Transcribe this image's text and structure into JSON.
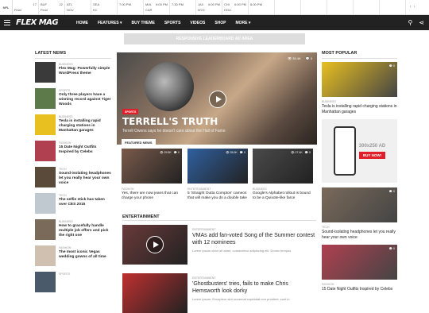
{
  "ticker": {
    "league": "NFL",
    "games": [
      {
        "t1": "",
        "s1": "17",
        "t2": "",
        "s2": "",
        "status": "Final"
      },
      {
        "t1": "BUF",
        "s1": "22",
        "t2": "",
        "s2": "",
        "status": "Final"
      },
      {
        "t1": "ATL",
        "s1": "",
        "t2": "",
        "s2": "",
        "status": "NOV"
      },
      {
        "t1": "SEA",
        "s1": "",
        "t2": "",
        "s2": "",
        "status": "KC"
      },
      {
        "t1": "",
        "s1": "",
        "t2": "",
        "s2": "",
        "status": "7:00 PM"
      },
      {
        "t1": "MIA",
        "s1": "",
        "t2": "CAR",
        "s2": "",
        "status": "6:00 PM"
      },
      {
        "t1": "",
        "s1": "",
        "t2": "",
        "s2": "",
        "status": "7:30 PM"
      },
      {
        "t1": "JAX",
        "s1": "",
        "t2": "NYG",
        "s2": "",
        "status": "6:00 PM"
      },
      {
        "t1": "CHI",
        "s1": "",
        "t2": "HOU",
        "s2": "",
        "status": "6:00 PM"
      },
      {
        "t1": "",
        "s1": "",
        "t2": "",
        "s2": "",
        "status": "6:00 PM"
      }
    ]
  },
  "nav": {
    "logo": "FLEX MAG",
    "items": [
      "HOME",
      "FEATURES ▾",
      "BUY THEME",
      "SPORTS",
      "VIDEOS",
      "SHOP",
      "MORE ▾"
    ]
  },
  "ad": {
    "text": "RESPONSIVE LEADERBOARD AD AREA"
  },
  "latest": {
    "title": "LATEST NEWS",
    "items": [
      {
        "cat": "BUSINESS",
        "title": "Flex Mag: Powerfully simple WordPress theme",
        "color": "#3a3a3a"
      },
      {
        "cat": "SPORTS",
        "title": "Only three players have a winning record against Tiger Woods",
        "color": "#5d7a4a"
      },
      {
        "cat": "BUSINESS",
        "title": "Tesla is installing rapid charging stations in Manhattan garages",
        "color": "#e8c020"
      },
      {
        "cat": "FASHION",
        "title": "15 Date Night Outfits Inspired by Celebs",
        "color": "#b04050"
      },
      {
        "cat": "TECH",
        "title": "Sound-isolating headphones let you really hear your own voice",
        "color": "#5a4a3a"
      },
      {
        "cat": "TECH",
        "title": "The selfie stick has taken over CES 2015",
        "color": "#c0c8d0"
      },
      {
        "cat": "BUSINESS",
        "title": "How to gracefully handle multiple job offers and pick the right one",
        "color": "#7a6a5a"
      },
      {
        "cat": "FASHION",
        "title": "The most iconic Vegas wedding gowns of all time",
        "color": "#d0c0b0"
      },
      {
        "cat": "SPORTS",
        "title": "",
        "color": "#4a5a6a"
      }
    ]
  },
  "featured": {
    "stats_views": "39.4K",
    "stats_comments": "0",
    "badge": "SPORTS",
    "title": "TERRELL'S TRUTH",
    "subtitle": "Terrell Owens says he doesn't care about the Hall of Fame",
    "tab": "FEATURED NEWS"
  },
  "featured_news": [
    {
      "cat": "FASHION",
      "title": "Yes, there are now jeans that can charge your phone",
      "views": "29.5K",
      "comments": "0",
      "color": "#7a5a4a"
    },
    {
      "cat": "ENTERTAINMENT",
      "title": "5 'Straight Outta Compton' cameos that will make you do a double take",
      "views": "28.0K",
      "comments": "0",
      "color": "#3060a0"
    },
    {
      "cat": "BUSINESS",
      "title": "Google's Alphabet rollout is bound to be a Quixote-like farce",
      "views": "27.4K",
      "comments": "0",
      "color": "#4a4a4a"
    }
  ],
  "entertainment": {
    "title": "ENTERTAINMENT",
    "items": [
      {
        "cat": "ENTERTAINMENT",
        "title": "VMAs add fan-voted Song of the Summer contest with 12 nominees",
        "excerpt": "Lorem ipsum dolor sit amet, consectetur adipiscing elit. Donec tempus",
        "color": "#6a3a3a"
      },
      {
        "cat": "ENTERTAINMENT",
        "title": "'Ghostbusters' tries, fails to make Chris Hemsworth look dorky",
        "excerpt": "Lorem ipsum. Excepteur sint occaecat cupidatat non proident, sunt in",
        "color": "#c03030"
      }
    ]
  },
  "popular": {
    "title": "MOST POPULAR",
    "items": [
      {
        "cat": "BUSINESS",
        "title": "Tesla is installing rapid charging stations in Manhattan garages",
        "views": "",
        "comments": "0",
        "color": "#e8c020"
      },
      {
        "cat": "TECH",
        "title": "Sound-isolating headphones let you really hear your own voice",
        "views": "",
        "comments": "0",
        "color": "#7a6a5a"
      },
      {
        "cat": "FASHION",
        "title": "15 Date Night Outfits Inspired by Celebs",
        "views": "",
        "comments": "0",
        "color": "#b04050"
      }
    ],
    "sidead": {
      "size": "300x250 AD",
      "button": "BUY NOW!"
    }
  }
}
